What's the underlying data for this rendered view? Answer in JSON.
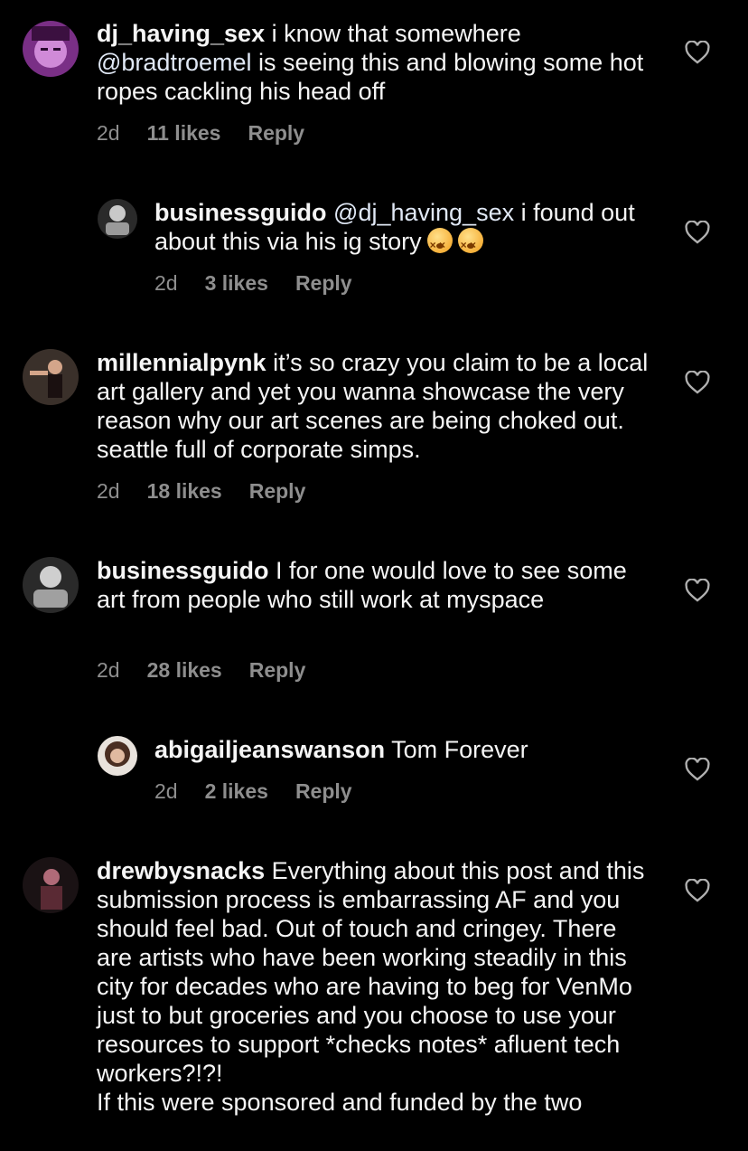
{
  "comments": [
    {
      "username": "dj_having_sex",
      "text_before": " i know that somewhere ",
      "mention": "@bradtroemel",
      "text_after": " is seeing this and blowing some hot ropes cackling his head off",
      "time": "2d",
      "likes": "11 likes",
      "reply": "Reply"
    },
    {
      "username": "businessguido",
      "mention": "@dj_having_sex",
      "text_after": " i found out about this via his ig story",
      "emoji": "dizzy-face-emoji",
      "time": "2d",
      "likes": "3 likes",
      "reply": "Reply"
    },
    {
      "username": "millennialpynk",
      "text": " it’s so crazy you claim to be a local art gallery and yet you wanna showcase the very reason why our art scenes are being choked out. seattle full of corporate simps.",
      "time": "2d",
      "likes": "18 likes",
      "reply": "Reply"
    },
    {
      "username": "businessguido",
      "text": " I for one would love to see some art from people who still work at myspace",
      "time": "2d",
      "likes": "28 likes",
      "reply": "Reply"
    },
    {
      "username": "abigailjeanswanson",
      "text": " Tom Forever",
      "time": "2d",
      "likes": "2 likes",
      "reply": "Reply"
    },
    {
      "username": "drewbysnacks",
      "text": " Everything about this post and this submission process is embarrassing AF and you should feel bad. Out of touch and cringey. There are artists who have been working steadily in this city for decades who are having to beg for VenMo just to but groceries and you choose to use your resources to support *checks notes* afluent tech workers?!?!",
      "text2": "If this were sponsored and funded by the two"
    }
  ]
}
